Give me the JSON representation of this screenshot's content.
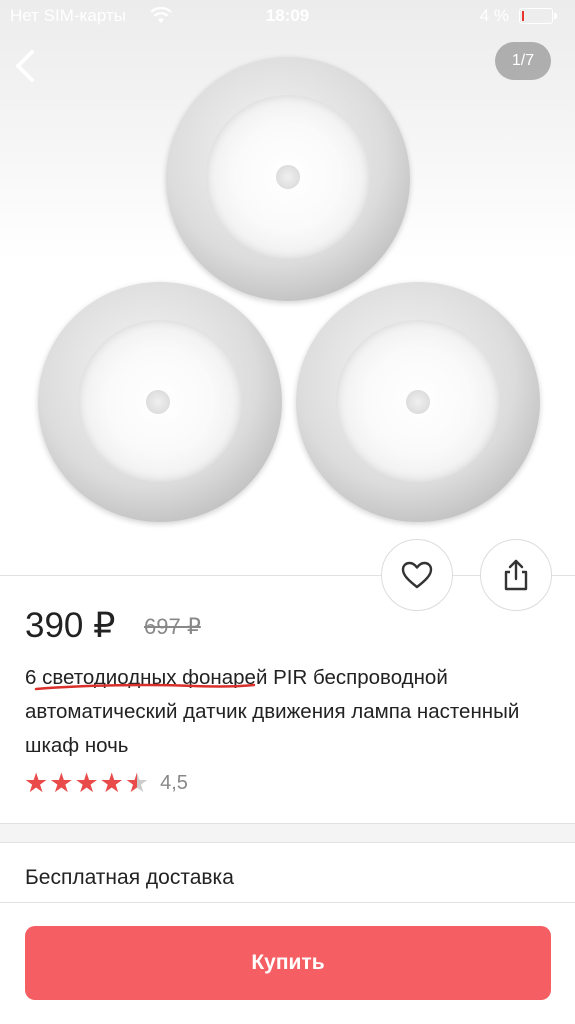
{
  "status_bar": {
    "carrier": "Нет SIM-карты",
    "time": "18:09",
    "battery_percent": "4 %",
    "battery_level": 0.04,
    "battery_color": "#e8352b"
  },
  "gallery": {
    "page_indicator": "1/7",
    "image_description_icon": "product-photo"
  },
  "product": {
    "price": "390 ₽",
    "old_price": "697 ₽",
    "title": "6 светодиодных фонарей PIR беспроводной автоматический датчик движения лампа настенный шкаф ночь",
    "rating_value": "4,5",
    "rating": 4.5,
    "rating_max": 5
  },
  "actions": {
    "favorite_icon": "heart-icon",
    "share_icon": "share-icon"
  },
  "delivery": {
    "label": "Бесплатная доставка"
  },
  "buy": {
    "label": "Купить",
    "color": "#f55e62"
  }
}
